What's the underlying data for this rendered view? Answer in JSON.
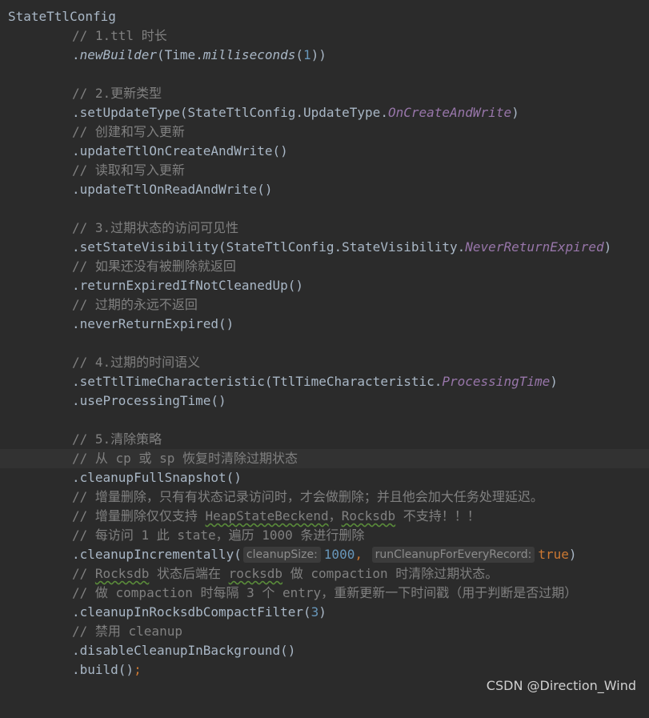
{
  "code": {
    "l1": "StateTtlConfig",
    "l2": "// 1.ttl 时长",
    "l3": {
      "a": ".",
      "b": "newBuilder",
      "c": "(Time.",
      "d": "milliseconds",
      "e": "(",
      "f": "1",
      "g": "))"
    },
    "l5": "// 2.更新类型",
    "l6": {
      "a": ".setUpdateType(StateTtlConfig.UpdateType.",
      "b": "OnCreateAndWrite",
      "c": ")"
    },
    "l7": "// 创建和写入更新",
    "l8": ".updateTtlOnCreateAndWrite()",
    "l9": "// 读取和写入更新",
    "l10": ".updateTtlOnReadAndWrite()",
    "l12": "// 3.过期状态的访问可见性",
    "l13": {
      "a": ".setStateVisibility(StateTtlConfig.StateVisibility.",
      "b": "NeverReturnExpired",
      "c": ")"
    },
    "l14": "// 如果还没有被删除就返回",
    "l15": ".returnExpiredIfNotCleanedUp()",
    "l16": "// 过期的永远不返回",
    "l17": ".neverReturnExpired()",
    "l19": "// 4.过期的时间语义",
    "l20": {
      "a": ".setTtlTimeCharacteristic(TtlTimeCharacteristic.",
      "b": "ProcessingTime",
      "c": ")"
    },
    "l21": ".useProcessingTime()",
    "l23": "// 5.清除策略",
    "l24": "// 从 cp 或 sp 恢复时清除过期状态",
    "l25": ".cleanupFullSnapshot()",
    "l26": "// 增量删除，只有有状态记录访问时，才会做删除；并且他会加大任务处理延迟。",
    "l27": {
      "a": "// 增量删除仅仅支持 ",
      "b": "HeapStateBeckend",
      "c": "，",
      "d": "Rocksdb",
      "e": " 不支持！！！"
    },
    "l28": "// 每访问 1 此 state，遍历 1000 条进行删除",
    "l29": {
      "a": ".cleanupIncrementally(",
      "hint1": "cleanupSize:",
      "b": "1000",
      "c": ", ",
      "hint2": "runCleanupForEveryRecord:",
      "d": "true",
      "e": ")"
    },
    "l30": {
      "a": "// ",
      "b": "Rocksdb",
      "c": " 状态后端在 ",
      "d": "rocksdb",
      "e": " 做 compaction 时清除过期状态。"
    },
    "l31": "// 做 compaction 时每隔 3 个 entry，重新更新一下时间戳（用于判断是否过期）",
    "l32": {
      "a": ".cleanupInRocksdbCompactFilter(",
      "b": "3",
      "c": ")"
    },
    "l33": "// 禁用 cleanup",
    "l34": ".disableCleanupInBackground()",
    "l35": {
      "a": ".build()",
      "b": ";"
    }
  },
  "watermark": "CSDN @Direction_Wind"
}
